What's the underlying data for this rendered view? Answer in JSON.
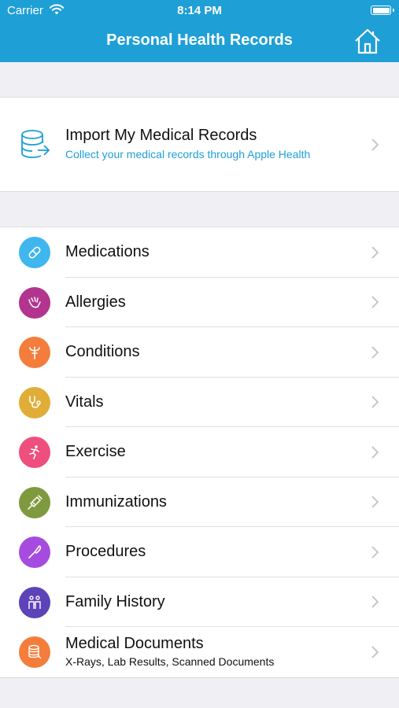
{
  "status_bar": {
    "carrier": "Carrier",
    "time": "8:14 PM"
  },
  "header": {
    "title": "Personal Health Records"
  },
  "import": {
    "title": "Import My Medical Records",
    "subtitle": "Collect your medical records through Apple Health"
  },
  "categories": [
    {
      "label": "Medications",
      "color": "#3fb6ee",
      "icon": "pill-icon"
    },
    {
      "label": "Allergies",
      "color": "#b2348e",
      "icon": "allergy-icon"
    },
    {
      "label": "Conditions",
      "color": "#f47d3c",
      "icon": "condition-icon"
    },
    {
      "label": "Vitals",
      "color": "#e0ae38",
      "icon": "stethoscope-icon"
    },
    {
      "label": "Exercise",
      "color": "#ef4f7c",
      "icon": "runner-icon"
    },
    {
      "label": "Immunizations",
      "color": "#7f9a3e",
      "icon": "syringe-icon"
    },
    {
      "label": "Procedures",
      "color": "#a64bdf",
      "icon": "scalpel-icon"
    },
    {
      "label": "Family History",
      "color": "#5d43b8",
      "icon": "family-icon"
    },
    {
      "label": "Medical Documents",
      "sublabel": "X-Rays, Lab Results, Scanned Documents",
      "color": "#f47d3c",
      "icon": "documents-icon"
    }
  ],
  "colors": {
    "accent": "#1e9fd6",
    "background": "#efeff4"
  }
}
